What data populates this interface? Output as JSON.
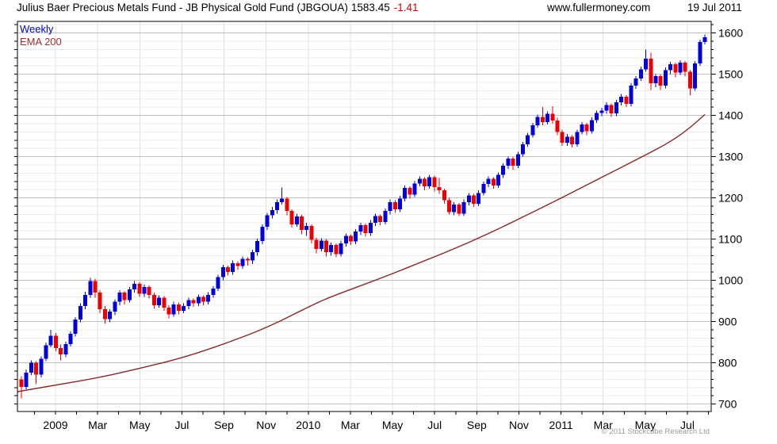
{
  "header": {
    "title": "Julius Baer Precious Metals Fund - JB Physical Gold Fund (JBGOUA)",
    "price": "1583.45",
    "change": "-1.41",
    "website": "www.fullermoney.com",
    "date": "19 Jul 2011"
  },
  "legend": {
    "series1": "Weekly",
    "series2": "EMA 200"
  },
  "footer": {
    "copyright": "© 2011 Stockcube Research Ltd"
  },
  "colors": {
    "up": "#0000dd",
    "down": "#ee0000",
    "ema": "#8b2828",
    "change": "#cc0000",
    "legend_weekly": "#0000cc",
    "legend_ema": "#993333",
    "grid_minor": "#ebebeb",
    "grid_major": "#c0c0c0",
    "grid_vertical": "#e0e0e0",
    "axis": "#000000",
    "copyright": "#9a9a9a"
  },
  "chart_data": {
    "type": "candlestick",
    "title": "Julius Baer Precious Metals Fund - JB Physical Gold Fund (JBGOUA)",
    "period": "Weekly",
    "last_price": 1583.45,
    "last_change": -1.41,
    "x_labels": [
      "2009",
      "Mar",
      "May",
      "Jul",
      "Sep",
      "Nov",
      "2010",
      "Mar",
      "May",
      "Jul",
      "Sep",
      "Nov",
      "2011",
      "Mar",
      "May",
      "Jul"
    ],
    "y_axis": {
      "min": 700,
      "max": 1600,
      "major_step": 100,
      "minor_step": 20,
      "labels": [
        "700",
        "800",
        "900",
        "1000",
        "1100",
        "1200",
        "1300",
        "1400",
        "1500",
        "1600"
      ]
    },
    "candles_ohlc": [
      [
        760,
        768,
        714,
        742
      ],
      [
        742,
        784,
        736,
        776
      ],
      [
        776,
        806,
        770,
        800
      ],
      [
        800,
        804,
        748,
        771
      ],
      [
        771,
        816,
        765,
        810
      ],
      [
        810,
        849,
        804,
        843
      ],
      [
        843,
        880,
        838,
        866
      ],
      [
        866,
        872,
        828,
        836
      ],
      [
        836,
        844,
        806,
        820
      ],
      [
        820,
        851,
        814,
        845
      ],
      [
        845,
        876,
        840,
        870
      ],
      [
        870,
        911,
        864,
        905
      ],
      [
        905,
        944,
        898,
        938
      ],
      [
        938,
        972,
        930,
        965
      ],
      [
        965,
        1006,
        958,
        998
      ],
      [
        998,
        1004,
        958,
        970
      ],
      [
        970,
        976,
        920,
        930
      ],
      [
        930,
        938,
        894,
        906
      ],
      [
        906,
        930,
        898,
        924
      ],
      [
        924,
        954,
        916,
        948
      ],
      [
        948,
        976,
        940,
        970
      ],
      [
        970,
        974,
        942,
        952
      ],
      [
        952,
        984,
        946,
        978
      ],
      [
        978,
        998,
        970,
        992
      ],
      [
        992,
        996,
        960,
        968
      ],
      [
        968,
        990,
        960,
        984
      ],
      [
        984,
        988,
        956,
        965
      ],
      [
        965,
        970,
        932,
        940
      ],
      [
        940,
        964,
        934,
        958
      ],
      [
        958,
        962,
        926,
        934
      ],
      [
        934,
        940,
        908,
        918
      ],
      [
        918,
        948,
        912,
        942
      ],
      [
        942,
        946,
        918,
        926
      ],
      [
        926,
        944,
        920,
        938
      ],
      [
        938,
        958,
        930,
        952
      ],
      [
        952,
        956,
        936,
        944
      ],
      [
        944,
        966,
        938,
        960
      ],
      [
        960,
        964,
        940,
        948
      ],
      [
        948,
        971,
        942,
        965
      ],
      [
        965,
        986,
        958,
        980
      ],
      [
        980,
        1014,
        974,
        1008
      ],
      [
        1008,
        1038,
        1000,
        1032
      ],
      [
        1032,
        1036,
        1012,
        1020
      ],
      [
        1020,
        1048,
        1014,
        1042
      ],
      [
        1042,
        1046,
        1026,
        1035
      ],
      [
        1035,
        1058,
        1028,
        1052
      ],
      [
        1052,
        1056,
        1036,
        1048
      ],
      [
        1048,
        1074,
        1040,
        1068
      ],
      [
        1068,
        1101,
        1060,
        1095
      ],
      [
        1095,
        1136,
        1088,
        1130
      ],
      [
        1130,
        1164,
        1122,
        1158
      ],
      [
        1158,
        1178,
        1150,
        1170
      ],
      [
        1170,
        1196,
        1162,
        1190
      ],
      [
        1190,
        1225,
        1184,
        1198
      ],
      [
        1198,
        1202,
        1158,
        1168
      ],
      [
        1168,
        1172,
        1128,
        1136
      ],
      [
        1136,
        1162,
        1130,
        1155
      ],
      [
        1155,
        1159,
        1112,
        1122
      ],
      [
        1122,
        1140,
        1108,
        1132
      ],
      [
        1132,
        1136,
        1090,
        1098
      ],
      [
        1098,
        1104,
        1066,
        1076
      ],
      [
        1076,
        1102,
        1070,
        1096
      ],
      [
        1096,
        1100,
        1058,
        1068
      ],
      [
        1068,
        1092,
        1060,
        1086
      ],
      [
        1086,
        1090,
        1056,
        1064
      ],
      [
        1064,
        1096,
        1058,
        1090
      ],
      [
        1090,
        1114,
        1082,
        1108
      ],
      [
        1108,
        1112,
        1086,
        1094
      ],
      [
        1094,
        1124,
        1088,
        1118
      ],
      [
        1118,
        1140,
        1110,
        1134
      ],
      [
        1134,
        1138,
        1106,
        1115
      ],
      [
        1115,
        1146,
        1108,
        1140
      ],
      [
        1140,
        1162,
        1132,
        1156
      ],
      [
        1156,
        1160,
        1134,
        1142
      ],
      [
        1142,
        1174,
        1136,
        1168
      ],
      [
        1168,
        1196,
        1160,
        1190
      ],
      [
        1190,
        1194,
        1164,
        1172
      ],
      [
        1172,
        1205,
        1166,
        1198
      ],
      [
        1198,
        1230,
        1192,
        1224
      ],
      [
        1224,
        1228,
        1198,
        1208
      ],
      [
        1208,
        1241,
        1202,
        1235
      ],
      [
        1235,
        1252,
        1228,
        1246
      ],
      [
        1246,
        1250,
        1218,
        1228
      ],
      [
        1228,
        1256,
        1222,
        1250
      ],
      [
        1250,
        1254,
        1216,
        1226
      ],
      [
        1226,
        1248,
        1210,
        1218
      ],
      [
        1218,
        1222,
        1186,
        1194
      ],
      [
        1194,
        1200,
        1160,
        1166
      ],
      [
        1166,
        1190,
        1158,
        1184
      ],
      [
        1184,
        1188,
        1156,
        1162
      ],
      [
        1162,
        1196,
        1156,
        1190
      ],
      [
        1190,
        1212,
        1182,
        1206
      ],
      [
        1206,
        1210,
        1178,
        1186
      ],
      [
        1186,
        1218,
        1180,
        1212
      ],
      [
        1212,
        1240,
        1206,
        1234
      ],
      [
        1234,
        1252,
        1226,
        1246
      ],
      [
        1246,
        1250,
        1222,
        1230
      ],
      [
        1230,
        1262,
        1224,
        1256
      ],
      [
        1256,
        1284,
        1248,
        1278
      ],
      [
        1278,
        1300,
        1270,
        1295
      ],
      [
        1295,
        1299,
        1268,
        1278
      ],
      [
        1278,
        1312,
        1272,
        1306
      ],
      [
        1306,
        1336,
        1300,
        1330
      ],
      [
        1330,
        1358,
        1324,
        1352
      ],
      [
        1352,
        1382,
        1346,
        1376
      ],
      [
        1376,
        1402,
        1370,
        1396
      ],
      [
        1396,
        1420,
        1376,
        1384
      ],
      [
        1384,
        1410,
        1378,
        1404
      ],
      [
        1404,
        1422,
        1380,
        1388
      ],
      [
        1388,
        1394,
        1352,
        1360
      ],
      [
        1360,
        1366,
        1326,
        1334
      ],
      [
        1334,
        1355,
        1326,
        1348
      ],
      [
        1348,
        1352,
        1322,
        1330
      ],
      [
        1330,
        1366,
        1324,
        1360
      ],
      [
        1360,
        1384,
        1354,
        1378
      ],
      [
        1378,
        1382,
        1352,
        1362
      ],
      [
        1362,
        1395,
        1356,
        1389
      ],
      [
        1389,
        1412,
        1382,
        1406
      ],
      [
        1406,
        1418,
        1398,
        1412
      ],
      [
        1412,
        1432,
        1404,
        1425
      ],
      [
        1425,
        1429,
        1396,
        1405
      ],
      [
        1405,
        1438,
        1398,
        1432
      ],
      [
        1432,
        1452,
        1424,
        1445
      ],
      [
        1445,
        1449,
        1420,
        1428
      ],
      [
        1428,
        1478,
        1422,
        1472
      ],
      [
        1472,
        1495,
        1465,
        1490
      ],
      [
        1490,
        1518,
        1484,
        1512
      ],
      [
        1512,
        1560,
        1506,
        1538
      ],
      [
        1538,
        1552,
        1462,
        1478
      ],
      [
        1478,
        1500,
        1468,
        1495
      ],
      [
        1495,
        1499,
        1462,
        1472
      ],
      [
        1472,
        1516,
        1466,
        1510
      ],
      [
        1510,
        1530,
        1500,
        1524
      ],
      [
        1524,
        1528,
        1492,
        1504
      ],
      [
        1504,
        1534,
        1498,
        1528
      ],
      [
        1528,
        1532,
        1494,
        1506
      ],
      [
        1506,
        1510,
        1448,
        1466
      ],
      [
        1466,
        1532,
        1460,
        1526
      ],
      [
        1526,
        1584,
        1520,
        1578
      ],
      [
        1578,
        1596,
        1572,
        1590
      ]
    ],
    "ema_200": {
      "name": "EMA 200",
      "anchors": [
        [
          -0.8,
          730
        ],
        [
          6.9,
          746
        ],
        [
          15.3,
          763
        ],
        [
          23.9,
          786
        ],
        [
          32.7,
          812
        ],
        [
          41.6,
          847
        ],
        [
          50.5,
          888
        ],
        [
          59.4,
          942
        ],
        [
          64.2,
          966
        ],
        [
          73.1,
          1005
        ],
        [
          81.9,
          1047
        ],
        [
          90.8,
          1090
        ],
        [
          99.7,
          1140
        ],
        [
          108.5,
          1192
        ],
        [
          117.4,
          1246
        ],
        [
          126.3,
          1300
        ],
        [
          131.1,
          1330
        ],
        [
          135.2,
          1362
        ],
        [
          139,
          1402
        ]
      ]
    }
  }
}
